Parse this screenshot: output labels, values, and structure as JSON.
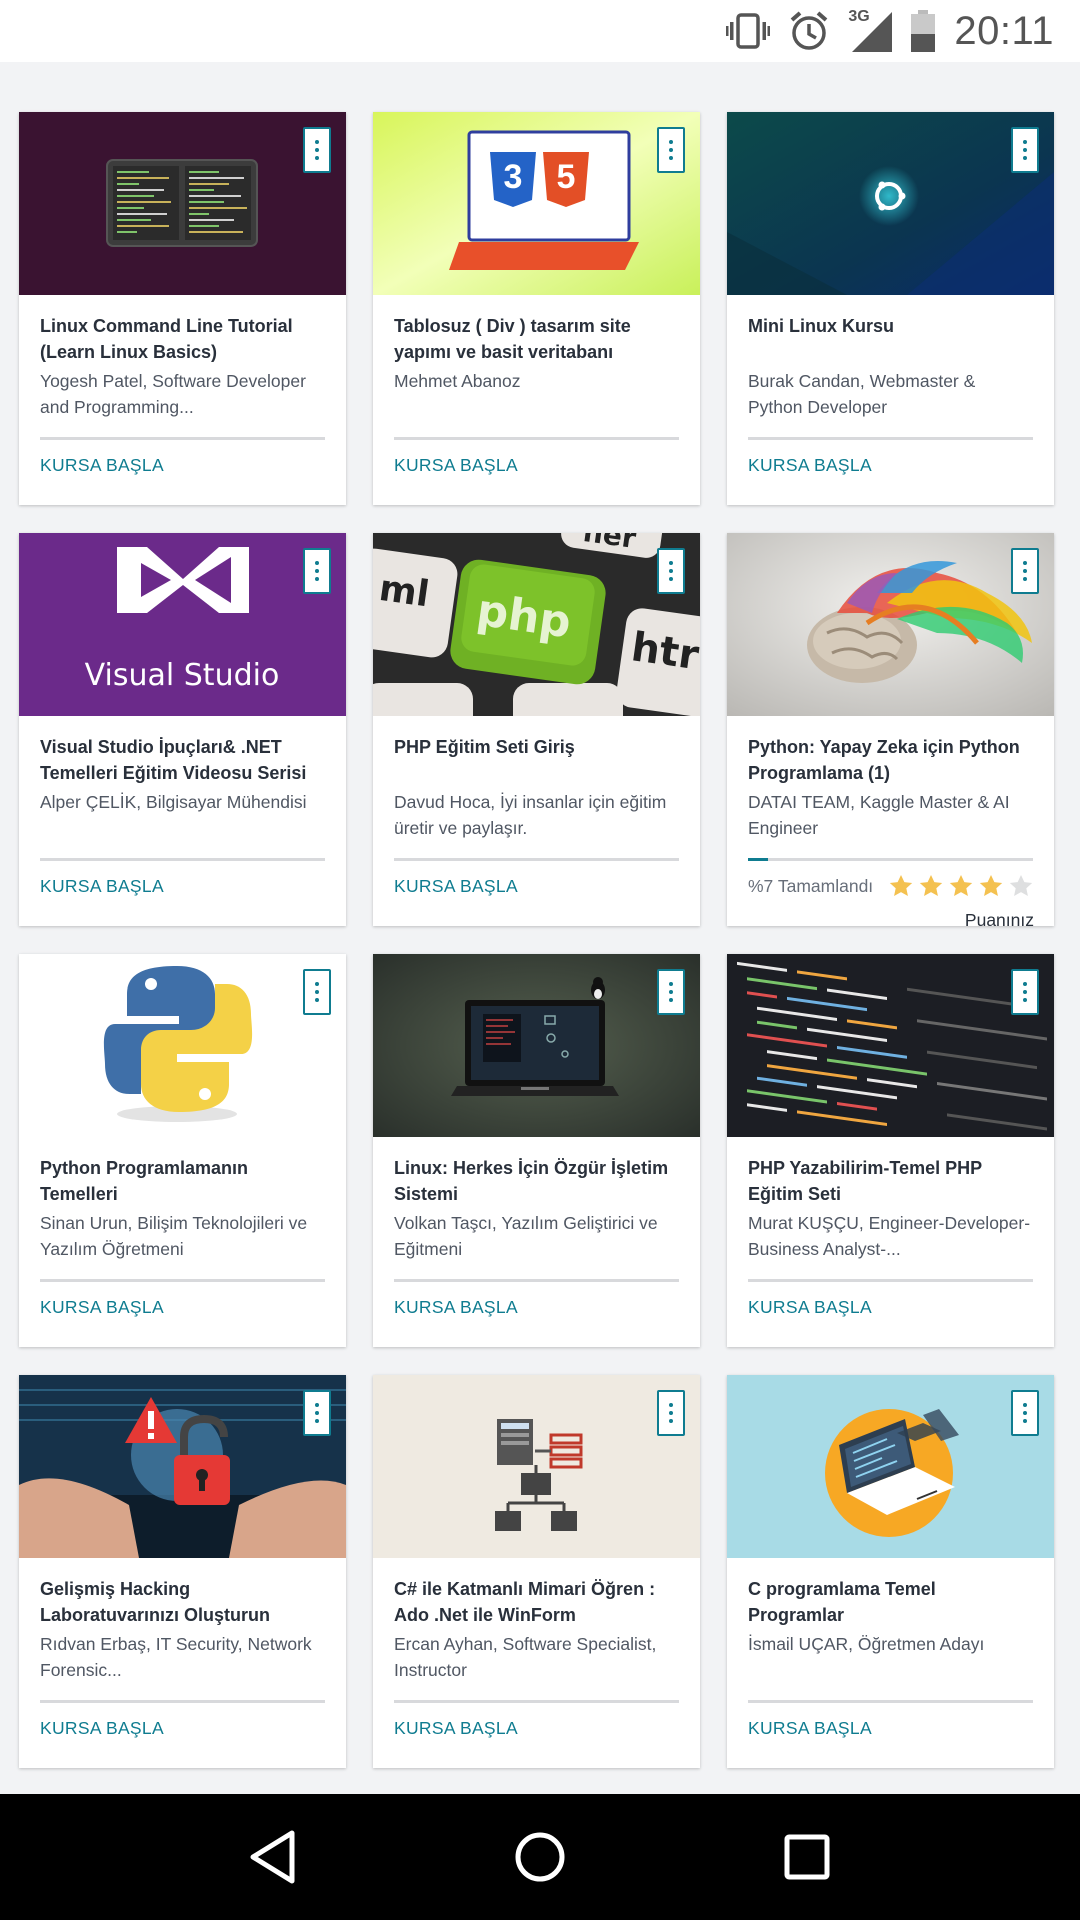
{
  "status_bar": {
    "time": "20:11",
    "network": "3G",
    "icons": [
      "vibrate-icon",
      "alarm-icon",
      "signal-icon",
      "battery-icon"
    ]
  },
  "courses": [
    {
      "title": "Linux Command Line Tutorial (Learn Linux Basics)",
      "author": "Yogesh Patel, Software Developer and Programming...",
      "cta": "KURSA BAŞLA",
      "thumb": "terminal",
      "thumb_bg": "#3a1331"
    },
    {
      "title": "Tablosuz ( Div ) tasarım site yapımı ve basit veritabanı",
      "author": "Mehmet Abanoz",
      "cta": "KURSA BAŞLA",
      "thumb": "css-html",
      "thumb_bg": "#e8f88a"
    },
    {
      "title": "Mini Linux Kursu",
      "author": "Burak Candan, Webmaster & Python Developer",
      "cta": "KURSA BAŞLA",
      "thumb": "ubuntu",
      "thumb_bg": "#0c3a4a"
    },
    {
      "title": "Visual Studio İpuçları& .NET Temelleri Eğitim Videosu Serisi",
      "author": "Alper ÇELİK, Bilgisayar Mühendisi",
      "cta": "KURSA BAŞLA",
      "thumb": "visual-studio",
      "thumb_bg": "#6b2a8a",
      "thumb_text": "Visual Studio"
    },
    {
      "title": "PHP Eğitim Seti Giriş",
      "author": "Davud Hoca, İyi insanlar için eğitim üretir ve paylaşır.",
      "cta": "KURSA BAŞLA",
      "thumb": "php-keyboard",
      "thumb_bg": "#d9d4cf",
      "thumb_text": "php"
    },
    {
      "title": "Python: Yapay Zeka için Python Programlama (1)",
      "author": "DATAI TEAM, Kaggle Master & AI Engineer",
      "thumb": "brain",
      "thumb_bg": "#d6d4d0",
      "progress_text": "%7 Tamamlandı",
      "progress": 0.07,
      "rating": 4,
      "rating_max": 5,
      "rating_label": "Puanınız"
    },
    {
      "title": "Python Programlamanın Temelleri",
      "author": "Sinan Urun, Bilişim Teknolojileri ve Yazılım Öğretmeni",
      "cta": "KURSA BAŞLA",
      "thumb": "python",
      "thumb_bg": "#ffffff"
    },
    {
      "title": "Linux: Herkes İçin Özgür İşletim Sistemi",
      "author": "Volkan Taşcı, Yazılım Geliştirici ve Eğitmeni",
      "cta": "KURSA BAŞLA",
      "thumb": "laptop",
      "thumb_bg": "#3b463f"
    },
    {
      "title": "PHP Yazabilirim-Temel PHP Eğitim Seti",
      "author": "Murat KUŞÇU, Engineer-Developer-Business Analyst-...",
      "cta": "KURSA BAŞLA",
      "thumb": "code",
      "thumb_bg": "#1c1e24"
    },
    {
      "title": "Gelişmiş Hacking Laboratuvarınızı Oluşturun",
      "author": "Rıdvan Erbaş, IT Security, Network Forensic...",
      "cta": "KURSA BAŞLA",
      "thumb": "hacking",
      "thumb_bg": "#16324a"
    },
    {
      "title": "C# ile Katmanlı Mimari Öğren : Ado .Net ile WinForm",
      "author": "Ercan Ayhan, Software Specialist, Instructor",
      "cta": "KURSA BAŞLA",
      "thumb": "architecture",
      "thumb_bg": "#efeae1"
    },
    {
      "title": "C programlama Temel Programlar",
      "author": "İsmail UÇAR, Öğretmen Adayı",
      "cta": "KURSA BAŞLA",
      "thumb": "c-laptop",
      "thumb_bg": "#a8dbe6"
    }
  ],
  "nav_bar": {
    "buttons": [
      "back-icon",
      "home-icon",
      "recents-icon"
    ]
  },
  "colors": {
    "accent": "#0f7c90",
    "star": "#f4c150",
    "star_empty": "#dedfe0"
  }
}
